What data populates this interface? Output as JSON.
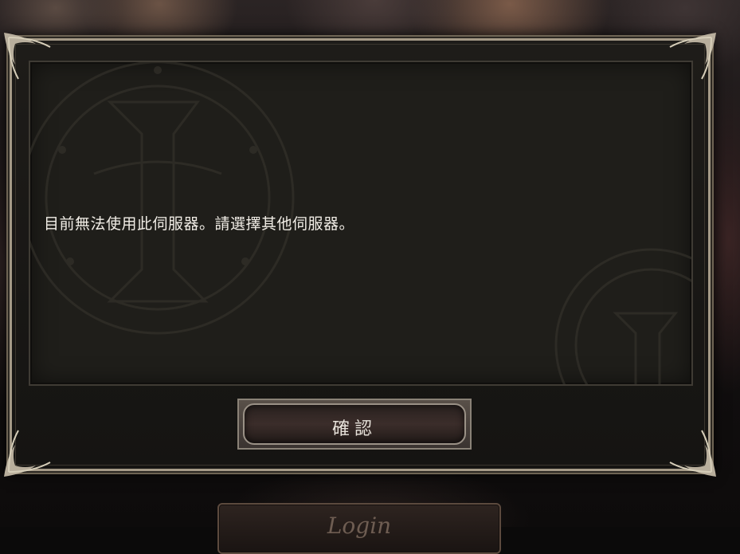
{
  "background": {
    "login_button_label": "Login"
  },
  "dialog": {
    "message": "目前無法使用此伺服器。請選擇其他伺服器。",
    "confirm_label": "確認"
  },
  "icons": {
    "emblem": "guild-emblem-icon",
    "corner": "ornament-corner-icon"
  },
  "colors": {
    "frame": "#a59a87",
    "panel": "#1f1e1a",
    "text": "#f1ede6"
  }
}
